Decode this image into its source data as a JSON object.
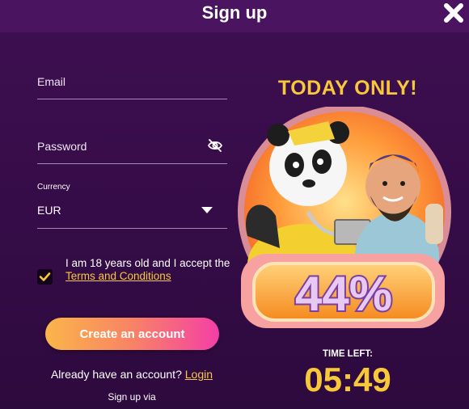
{
  "dialog": {
    "title": "Sign up"
  },
  "form": {
    "email_label": "Email",
    "password_label": "Password",
    "currency_label": "Currency",
    "currency_value": "EUR",
    "age_checked": true,
    "terms_text": "I am 18 years old and I accept the ",
    "terms_link": "Terms and Conditions",
    "submit_label": "Create an account",
    "already_text": "Already have an account?",
    "login_link": "Login",
    "signup_via": "Sign up via"
  },
  "promo": {
    "headline": "TODAY ONLY!",
    "discount": "44%",
    "time_left_label": "TIME LEFT:",
    "countdown": "05:49"
  },
  "colors": {
    "accent_yellow": "#f6c83a",
    "background": "#3a0d4c",
    "header": "#4a1460",
    "button_gradient": [
      "#fbb54a",
      "#f43fa6"
    ]
  },
  "icons": {
    "close": "close-icon",
    "password_visibility": "eye-slash-icon",
    "dropdown": "chevron-down-icon",
    "checkbox": "check-icon"
  }
}
